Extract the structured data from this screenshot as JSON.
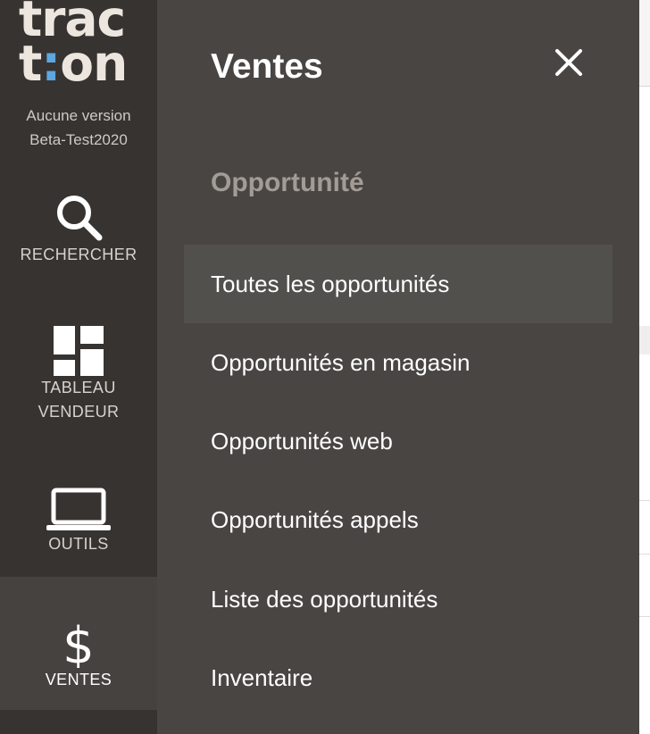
{
  "logo": {
    "line1": "trac",
    "line2_a": "t",
    "line2_colon": ":",
    "line2_b": "on"
  },
  "version": {
    "line1": "Aucune version",
    "line2": "Beta-Test2020"
  },
  "rail": [
    {
      "id": "search",
      "label": "RECHERCHER",
      "icon": "search-icon"
    },
    {
      "id": "tableau",
      "label_line1": "TABLEAU",
      "label_line2": "VENDEUR",
      "icon": "dashboard-icon"
    },
    {
      "id": "outils",
      "label": "OUTILS",
      "icon": "laptop-icon"
    },
    {
      "id": "ventes",
      "label": "VENTES",
      "icon": "dollar-icon",
      "active": true
    }
  ],
  "panel": {
    "title": "Ventes",
    "section": "Opportunité",
    "items": [
      "Toutes les opportunités",
      "Opportunités en magasin",
      "Opportunités web",
      "Opportunités appels",
      "Liste des opportunités",
      "Inventaire"
    ],
    "active_index": 0
  },
  "colors": {
    "rail": "#373331",
    "panel": "#484543",
    "active_item": "#52504d",
    "logo_accent": "#5da6e0"
  }
}
